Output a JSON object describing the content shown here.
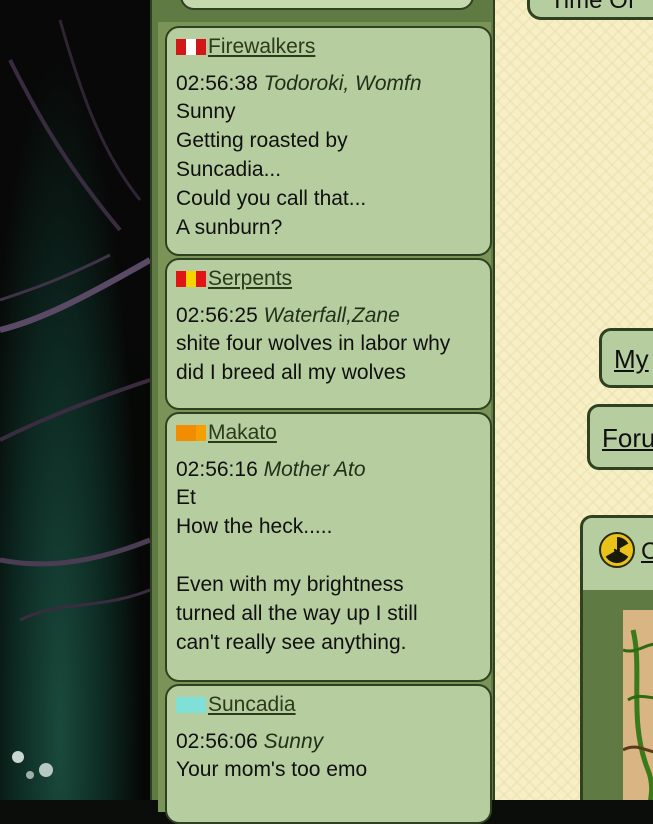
{
  "chat": {
    "messages": [
      {
        "tribe": "Firewalkers",
        "flag_colors": [
          "#d01818",
          "#ffffff",
          "#d01818"
        ],
        "time": "02:56:38",
        "author": "Todoroki, Womfn",
        "text": "Sunny\nGetting roasted by\nSuncadia...\nCould you call that...\nA sunburn?"
      },
      {
        "tribe": "Serpents",
        "flag_colors": [
          "#e01515",
          "#f5d400",
          "#e01515"
        ],
        "time": "02:56:25",
        "author": "Waterfall,Zane",
        "text": "shite four wolves in labor why\ndid I breed all my wolves"
      },
      {
        "tribe": "Makato",
        "flag_colors": [
          "#f28c00",
          "#f28c00",
          "#f5a000"
        ],
        "time": "02:56:16",
        "author": "Mother Ato",
        "text": "Et\nHow the heck.....\n\nEven with my brightness\nturned all the way up I still\ncan't really see anything."
      },
      {
        "tribe": "Suncadia",
        "flag_colors": [
          "#7fe0d8",
          "#7fe0d8",
          "#7fe0d8"
        ],
        "time": "02:56:06",
        "author": "Sunny",
        "text": "Your mom's too emo"
      }
    ]
  },
  "right_panel": {
    "time_tab_label": "Time Of",
    "my_button_label": "My",
    "forum_button_label": "Foru",
    "panel_title": "C",
    "panel_icon": "radiation-icon"
  }
}
